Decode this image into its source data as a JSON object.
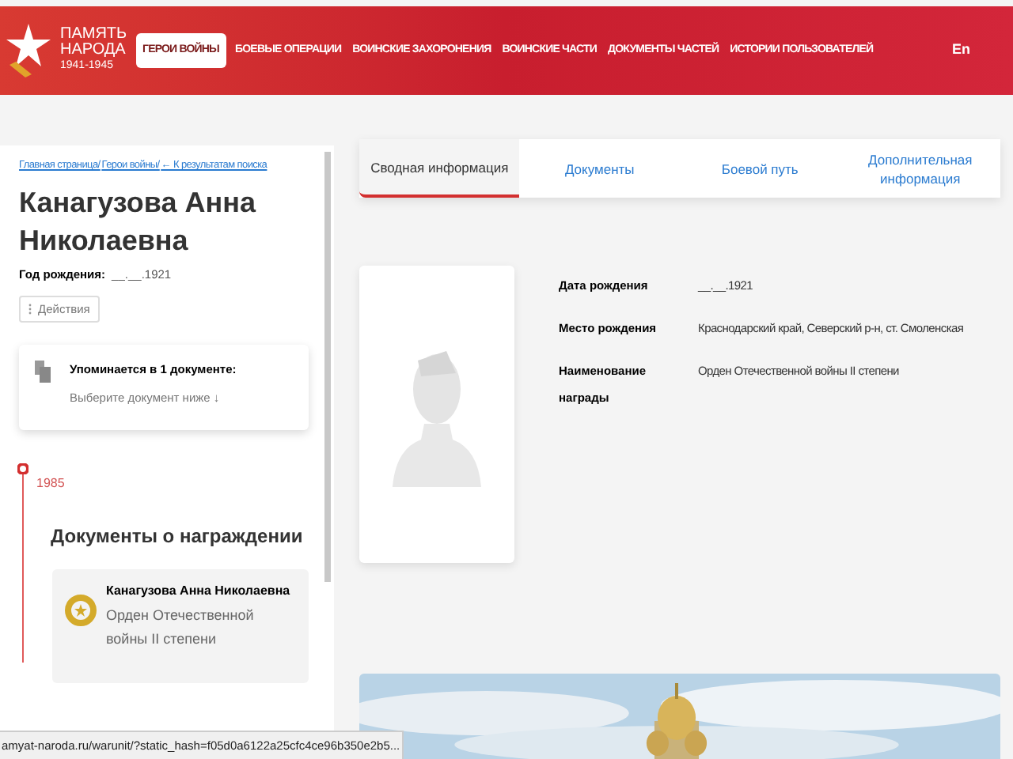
{
  "logo": {
    "title_line1": "ПАМЯТЬ",
    "title_line2": "НАРОДА",
    "years": "1941-1945"
  },
  "nav": [
    {
      "label": "ГЕРОИ ВОЙНЫ",
      "selected": true
    },
    {
      "label": "БОЕВЫЕ ОПЕРАЦИИ",
      "selected": false
    },
    {
      "label": "ВОИНСКИЕ ЗАХОРОНЕНИЯ",
      "selected": false
    },
    {
      "label": "ВОИНСКИЕ ЧАСТИ",
      "selected": false
    },
    {
      "label": "ДОКУМЕНТЫ ЧАСТЕЙ",
      "selected": false
    },
    {
      "label": "ИСТОРИИ ПОЛЬЗОВАТЕЛЕЙ",
      "selected": false
    }
  ],
  "language": {
    "label": "En",
    "selected": false
  },
  "breadcrumbs": [
    "Главная страница/",
    "Герои войны/",
    "← К результатам поиска"
  ],
  "person": {
    "name": "Канагузова Анна Николаевна",
    "birth_label": "Год рождения:",
    "birth_value": "__.__.1921"
  },
  "actions_button": "Действия",
  "mentions": {
    "title": "Упоминается в 1 документе:",
    "hint": "Выберите документ ниже ↓"
  },
  "timeline": {
    "year": "1985",
    "section_title": "Документы о награждении",
    "card": {
      "name": "Канагузова Анна Николаевна",
      "award": "Орден Отечественной войны II степени"
    }
  },
  "tabs": [
    {
      "label": "Сводная информация",
      "selected": true
    },
    {
      "label": "Документы",
      "selected": false
    },
    {
      "label": "Боевой путь",
      "selected": false
    },
    {
      "label": "Дополнительная информация",
      "selected": false
    }
  ],
  "details": [
    {
      "label": "Дата рождения",
      "value": "__.__.1921"
    },
    {
      "label": "Место рождения",
      "value": "Краснодарский край, Северский р-н, ст. Смоленская"
    },
    {
      "label": "Наименование награды",
      "value": "Орден Отечественной войны II степени"
    }
  ],
  "banner": {
    "kind": "picture"
  },
  "status_bar": "amyat-naroda.ru/warunit/?static_hash=f05d0a6122a25cfc4ce96b350e2b5..."
}
